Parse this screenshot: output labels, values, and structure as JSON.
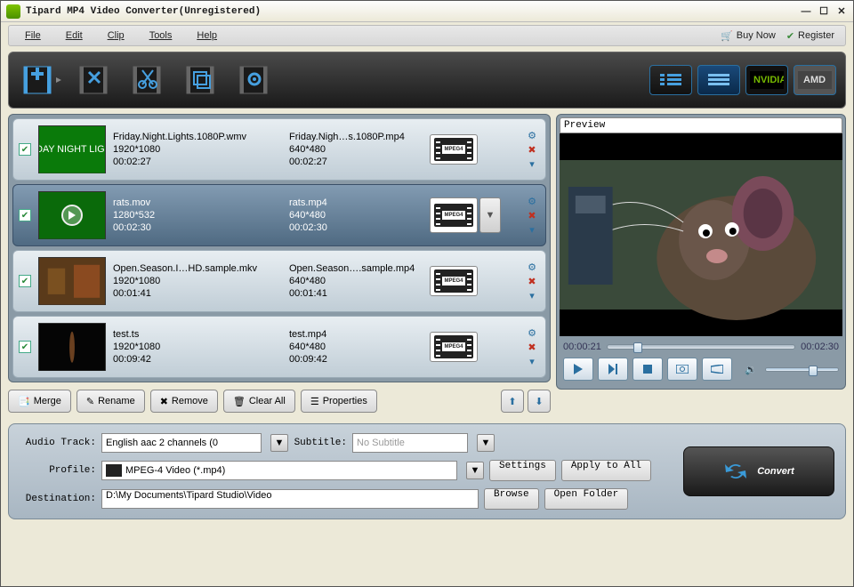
{
  "title": "Tipard MP4 Video Converter(Unregistered)",
  "menu": {
    "file": "File",
    "edit": "Edit",
    "clip": "Clip",
    "tools": "Tools",
    "help": "Help",
    "buy": "Buy Now",
    "register": "Register"
  },
  "files": [
    {
      "src_name": "Friday.Night.Lights.1080P.wmv",
      "src_res": "1920*1080",
      "src_dur": "00:02:27",
      "dst_name": "Friday.Nigh…s.1080P.mp4",
      "dst_res": "640*480",
      "dst_dur": "00:02:27",
      "selected": false,
      "thumb": "green-text"
    },
    {
      "src_name": "rats.mov",
      "src_res": "1280*532",
      "src_dur": "00:02:30",
      "dst_name": "rats.mp4",
      "dst_res": "640*480",
      "dst_dur": "00:02:30",
      "selected": true,
      "thumb": "green-play"
    },
    {
      "src_name": "Open.Season.I…HD.sample.mkv",
      "src_res": "1920*1080",
      "src_dur": "00:01:41",
      "dst_name": "Open.Season….sample.mp4",
      "dst_res": "640*480",
      "dst_dur": "00:01:41",
      "selected": false,
      "thumb": "brown"
    },
    {
      "src_name": "test.ts",
      "src_res": "1920*1080",
      "src_dur": "00:09:42",
      "dst_name": "test.mp4",
      "dst_res": "640*480",
      "dst_dur": "00:09:42",
      "selected": false,
      "thumb": "dark"
    }
  ],
  "list_buttons": {
    "merge": "Merge",
    "rename": "Rename",
    "remove": "Remove",
    "clear": "Clear All",
    "properties": "Properties"
  },
  "preview": {
    "label": "Preview",
    "pos": "00:00:21",
    "total": "00:02:30"
  },
  "form": {
    "audio_label": "Audio Track:",
    "audio_value": "English aac 2 channels (0",
    "subtitle_label": "Subtitle:",
    "subtitle_value": "No Subtitle",
    "profile_label": "Profile:",
    "profile_value": "MPEG-4 Video (*.mp4)",
    "settings": "Settings",
    "apply": "Apply to All",
    "dest_label": "Destination:",
    "dest_value": "D:\\My Documents\\Tipard Studio\\Video",
    "browse": "Browse",
    "open": "Open Folder"
  },
  "convert": "Convert",
  "mpeg_label": "MPEG4"
}
